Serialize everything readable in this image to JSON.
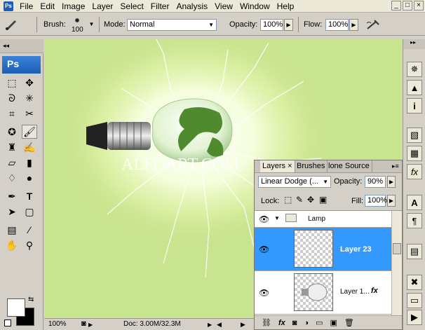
{
  "menu": {
    "items": [
      "File",
      "Edit",
      "Image",
      "Layer",
      "Select",
      "Filter",
      "Analysis",
      "View",
      "Window",
      "Help"
    ],
    "window_controls": [
      "_",
      "□",
      "×"
    ]
  },
  "options": {
    "brush_label": "Brush:",
    "brush_size": "100",
    "mode_label": "Mode:",
    "mode_value": "Normal",
    "opacity_label": "Opacity:",
    "opacity_value": "100%",
    "flow_label": "Flow:",
    "flow_value": "100%"
  },
  "toolbox": {
    "badge": "Ps"
  },
  "canvas": {
    "watermark": "ALFOART.COM"
  },
  "status": {
    "zoom": "100%",
    "doc": "Doc: 3.00M/32.3M"
  },
  "layers_panel": {
    "tabs": [
      "Layers",
      "Brushes",
      "lone Source"
    ],
    "tab_close": "×",
    "blend_mode": "Linear Dodge (...",
    "opacity_label": "Opacity:",
    "opacity_value": "90%",
    "lock_label": "Lock:",
    "fill_label": "Fill:",
    "fill_value": "100%",
    "group_name": "Lamp",
    "layers": [
      {
        "name": "Layer 23",
        "selected": true
      },
      {
        "name": "Layer 1...",
        "selected": false,
        "fx": "fx"
      }
    ],
    "bottom_icons": [
      "link-icon",
      "fx-icon",
      "mask-icon",
      "adjustment-icon",
      "folder-icon",
      "new-layer-icon",
      "trash-icon"
    ],
    "bottom_fx": "fx"
  },
  "colors": {
    "canvas_bg": "#c9e48f",
    "selection": "#3399ff",
    "ps_blue": "#1f5fb8"
  }
}
